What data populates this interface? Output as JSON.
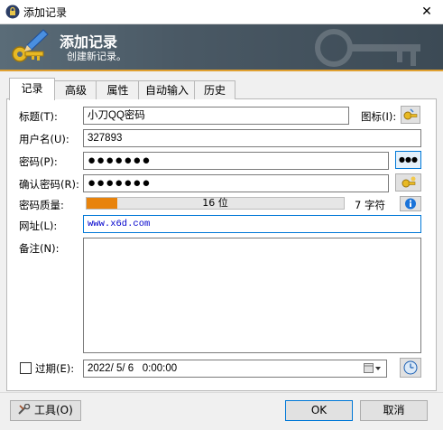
{
  "window": {
    "title": "添加记录",
    "close_glyph": "✕"
  },
  "banner": {
    "heading": "添加记录",
    "subtitle": "创建新记录。"
  },
  "tabs": [
    {
      "label": "记录",
      "active": true
    },
    {
      "label": "高级",
      "active": false
    },
    {
      "label": "属性",
      "active": false
    },
    {
      "label": "自动输入",
      "active": false
    },
    {
      "label": "历史",
      "active": false
    }
  ],
  "form": {
    "title_label": "标题(T):",
    "title_value": "小刀QQ密码",
    "icon_label": "图标(I):",
    "username_label": "用户名(U):",
    "username_value": "327893",
    "password_label": "密码(P):",
    "password_value": "●●●●●●●",
    "show_password_glyph": "●●●",
    "confirm_label": "确认密码(R):",
    "confirm_value": "●●●●●●●",
    "quality_label": "密码质量:",
    "quality_bits": "16 位",
    "quality_level": 0.12,
    "quality_chars": "7 字符",
    "url_label": "网址(L):",
    "url_value": "www.x6d.com",
    "notes_label": "备注(N):",
    "notes_value": "",
    "expires_label": "过期(E):",
    "expires_checked": false,
    "expires_value": "2022/ 5/ 6   0:00:00"
  },
  "buttons": {
    "tools": "工具(O)",
    "ok": "OK",
    "cancel": "取消"
  },
  "colors": {
    "accent": "#0078d7",
    "quality_fill": "#e8830c",
    "banner": "#4a5965"
  }
}
